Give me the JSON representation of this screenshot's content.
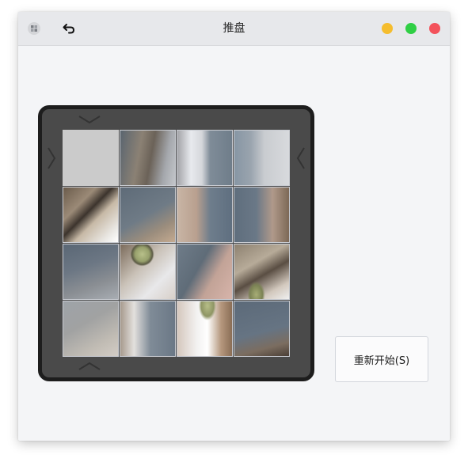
{
  "window": {
    "title": "推盘",
    "controls": {
      "minimize": "#f5bd2e",
      "maximize": "#30cf45",
      "close": "#f3525b"
    }
  },
  "icons": {
    "app": "app-icon",
    "back": "undo-arrow-icon"
  },
  "board": {
    "rows": 4,
    "cols": 4,
    "empty_tile": {
      "row": 0,
      "col": 0
    },
    "arrows": [
      "chevron-down-icon",
      "chevron-right-icon",
      "chevron-left-icon",
      "chevron-up-icon"
    ]
  },
  "controls": {
    "restart_label": "重新开始(S)"
  }
}
